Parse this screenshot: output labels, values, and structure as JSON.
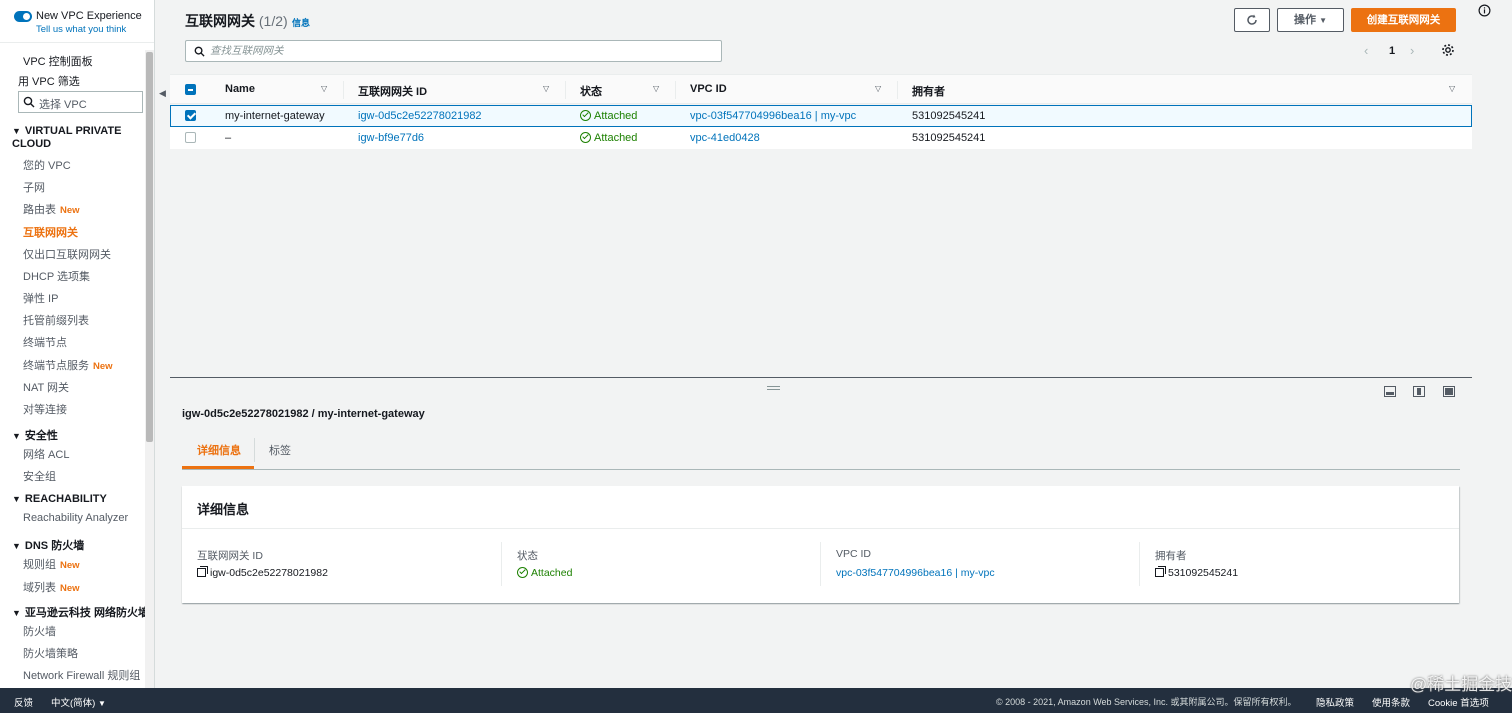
{
  "sidebar": {
    "toggle_title": "New VPC Experience",
    "toggle_link": "Tell us what you think",
    "dashboard": "VPC 控制面板",
    "filter_label": "用 VPC 筛选",
    "filter_placeholder": "选择 VPC",
    "new_badge": "New",
    "sections": {
      "vpc": "VIRTUAL PRIVATE CLOUD",
      "security": "安全性",
      "reachability": "REACHABILITY",
      "dns_firewall": "DNS 防火墙",
      "network_firewall": "亚马逊云科技 网络防火墙"
    },
    "items": {
      "your_vpcs": "您的 VPC",
      "subnets": "子网",
      "route_tables": "路由表",
      "internet_gateways": "互联网网关",
      "egress_only_igw": "仅出口互联网网关",
      "dhcp_options": "DHCP 选项集",
      "elastic_ip": "弹性 IP",
      "managed_prefix_lists": "托管前缀列表",
      "endpoints": "终端节点",
      "endpoint_services": "终端节点服务",
      "nat_gateways": "NAT 网关",
      "peering": "对等连接",
      "network_acl": "网络 ACL",
      "security_groups": "安全组",
      "reachability_analyzer": "Reachability Analyzer",
      "rule_groups": "规则组",
      "domain_lists": "域列表",
      "firewalls": "防火墙",
      "firewall_policies": "防火墙策略",
      "nf_rule_groups": "Network Firewall 规则组"
    }
  },
  "header": {
    "title": "互联网网关",
    "count": "(1/2)",
    "info": "信息",
    "actions_label": "操作",
    "create_label": "创建互联网网关",
    "search_placeholder": "查找互联网网关",
    "page_number": "1"
  },
  "table": {
    "columns": [
      "Name",
      "互联网网关 ID",
      "状态",
      "VPC ID",
      "拥有者"
    ],
    "rows": [
      {
        "name": "my-internet-gateway",
        "id": "igw-0d5c2e52278021982",
        "status": "Attached",
        "vpc": "vpc-03f547704996bea16 | my-vpc",
        "owner": "531092545241"
      },
      {
        "name": "–",
        "id": "igw-bf9e77d6",
        "status": "Attached",
        "vpc": "vpc-41ed0428",
        "owner": "531092545241"
      }
    ]
  },
  "detail": {
    "title": "igw-0d5c2e52278021982 / my-internet-gateway",
    "tabs": [
      "详细信息",
      "标签"
    ],
    "card_title": "详细信息",
    "fields": [
      {
        "label": "互联网网关 ID",
        "value": "igw-0d5c2e52278021982"
      },
      {
        "label": "状态",
        "value": "Attached"
      },
      {
        "label": "VPC ID",
        "value": "vpc-03f547704996bea16 | my-vpc"
      },
      {
        "label": "拥有者",
        "value": "531092545241"
      }
    ]
  },
  "footer": {
    "feedback": "反馈",
    "language": "中文(简体)",
    "copyright": "© 2008 - 2021, Amazon Web Services, Inc. 或其附属公司。保留所有权利。",
    "privacy": "隐私政策",
    "terms": "使用条款",
    "cookie": "Cookie 首选项"
  },
  "watermark": "@稀土掘金技术社区",
  "colors": {
    "accent": "#ec7211",
    "link": "#0073bb",
    "success": "#1d8102",
    "footer_bg": "#232f3e"
  }
}
